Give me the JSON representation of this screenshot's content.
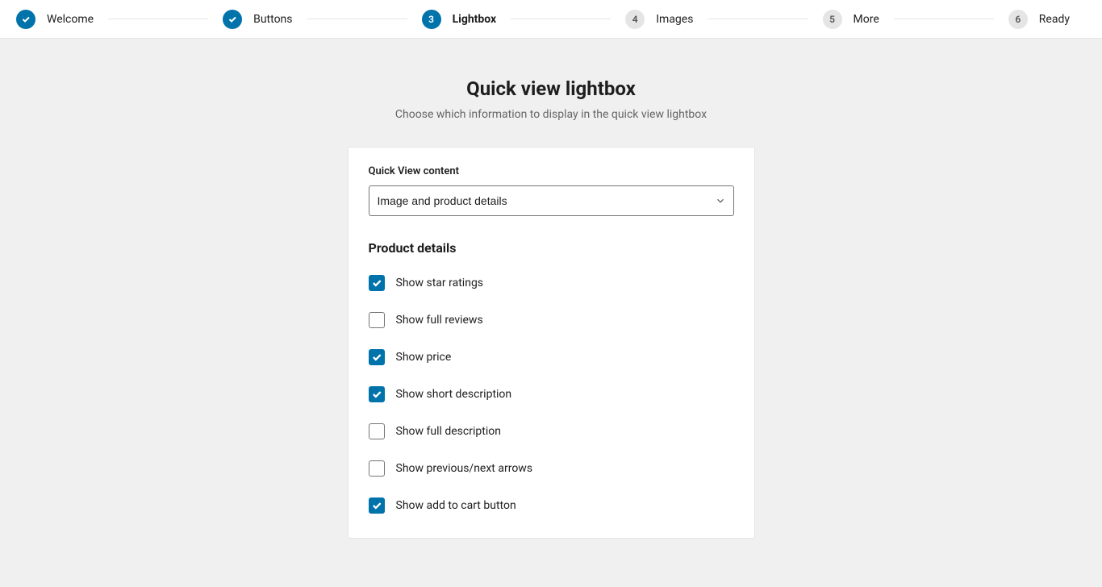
{
  "stepper": {
    "steps": [
      {
        "id": "welcome",
        "label": "Welcome",
        "state": "done",
        "number": "1"
      },
      {
        "id": "buttons",
        "label": "Buttons",
        "state": "done",
        "number": "2"
      },
      {
        "id": "lightbox",
        "label": "Lightbox",
        "state": "active",
        "number": "3"
      },
      {
        "id": "images",
        "label": "Images",
        "state": "todo",
        "number": "4"
      },
      {
        "id": "more",
        "label": "More",
        "state": "todo",
        "number": "5"
      },
      {
        "id": "ready",
        "label": "Ready",
        "state": "todo",
        "number": "6"
      }
    ]
  },
  "page": {
    "title": "Quick view lightbox",
    "subtitle": "Choose which information to display in the quick view lightbox"
  },
  "form": {
    "content_select": {
      "label": "Quick View content",
      "value": "Image and product details"
    },
    "section_heading": "Product details",
    "checkboxes": [
      {
        "id": "star-ratings",
        "label": "Show star ratings",
        "checked": true
      },
      {
        "id": "full-reviews",
        "label": "Show full reviews",
        "checked": false
      },
      {
        "id": "price",
        "label": "Show price",
        "checked": true
      },
      {
        "id": "short-description",
        "label": "Show short description",
        "checked": true
      },
      {
        "id": "full-description",
        "label": "Show full description",
        "checked": false
      },
      {
        "id": "prev-next-arrows",
        "label": "Show previous/next arrows",
        "checked": false
      },
      {
        "id": "add-to-cart",
        "label": "Show add to cart button",
        "checked": true
      }
    ]
  },
  "colors": {
    "accent": "#0073aa",
    "page_bg": "#f0f0f0",
    "card_bg": "#ffffff",
    "border": "#e5e5e5",
    "muted_text": "#666666"
  }
}
